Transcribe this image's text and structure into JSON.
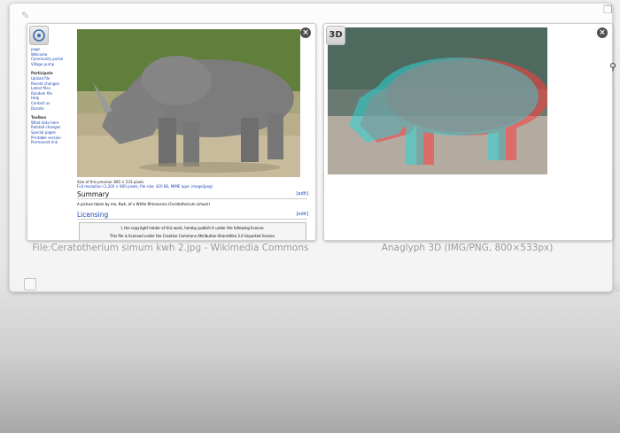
{
  "left_thumb": {
    "caption": "File:Ceratotherium simum kwh 2.jpg - Wikimedia Commons",
    "sidebar_group1": [
      "page",
      "Welcome",
      "Community portal",
      "Village pump"
    ],
    "sidebar_heading2": "Participate",
    "sidebar_group2": [
      "Upload file",
      "Recent changes",
      "Latest files",
      "Random file",
      "Help",
      "Contact us",
      "Donate"
    ],
    "sidebar_heading3": "Toolbox",
    "sidebar_group3": [
      "What links here",
      "Related changes",
      "Special pages",
      "Printable version",
      "Permanent link"
    ],
    "file_size_line": "Size of this preview: 800 × 533 pixels",
    "full_res_line": "Full resolution (1,200 × 800 pixels, file size: 420 KB, MIME type: image/jpeg)",
    "summary_heading": "Summary",
    "summary_edit": "[edit]",
    "summary_text": "A picture taken by me, Kwh, of a White Rhinoceros (Ceratotherium simum)",
    "licensing_heading": "Licensing",
    "licensing_edit": "[edit]",
    "license_text_1": "I, the copyright holder of this work, hereby publish it under the following license:",
    "license_text_2": "This file is licensed under the Creative Commons Attribution-ShareAlike 3.0 Unported license."
  },
  "right_thumb": {
    "badge": "3D",
    "caption": "Anaglyph 3D (IMG/PNG, 800×533px)"
  },
  "icons": {
    "close": "×",
    "edit": "✎",
    "windows": "❐",
    "search": "⚲"
  }
}
